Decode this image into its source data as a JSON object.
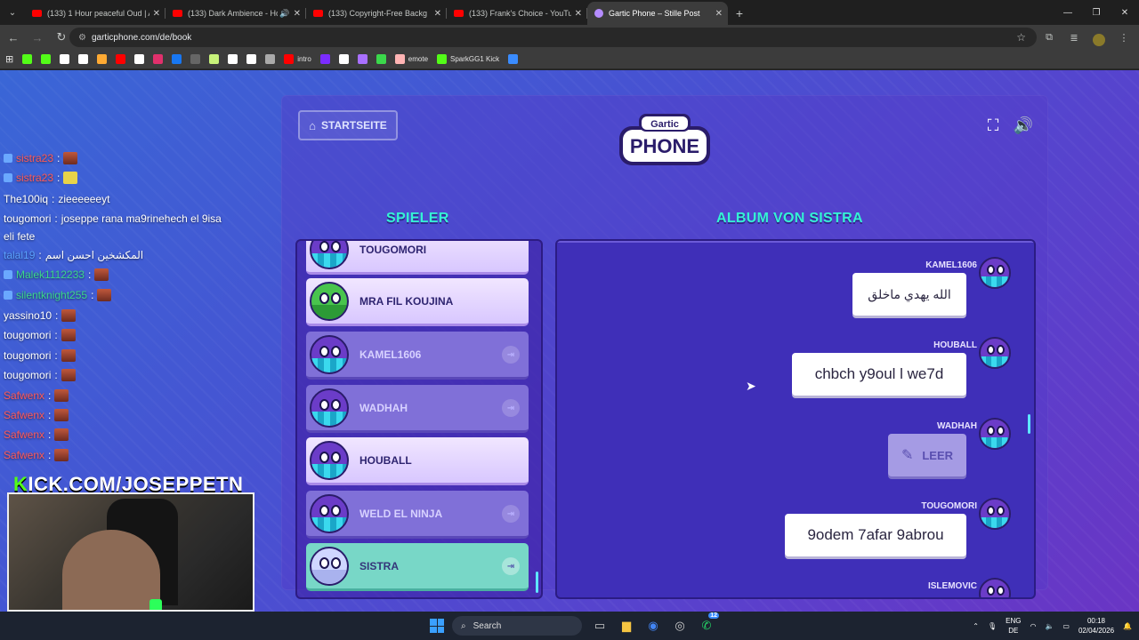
{
  "browser": {
    "tabs": [
      {
        "title": "(133) 1 Hour peaceful Oud | Ar",
        "favicon": "youtube-icon",
        "active": false
      },
      {
        "title": "(133) Dark Ambience - Hor",
        "favicon": "youtube-icon",
        "active": false,
        "audio": true
      },
      {
        "title": "(133) Copyright-Free Backg",
        "favicon": "youtube-icon",
        "active": false
      },
      {
        "title": "(133) Frank's Choice - YouTube",
        "favicon": "youtube-icon",
        "active": false
      },
      {
        "title": "Gartic Phone – Stille Post",
        "favicon": "gartic-icon",
        "active": true
      }
    ],
    "url": "garticphone.com/de/book",
    "bookmarks": [
      "",
      "",
      "",
      "",
      "",
      "",
      "",
      "",
      "",
      "",
      "",
      "",
      "",
      "",
      "intro",
      "",
      "",
      "",
      "",
      "emote",
      "SparkGG1 Kick",
      ""
    ]
  },
  "game": {
    "home_label": "STARTSEITE",
    "logo_top": "Gartic",
    "logo_main": "PHONE",
    "players_title": "SPIELER",
    "album_title": "ALBUM VON SISTRA",
    "players": [
      {
        "name": "TOUGOMORI",
        "style": "bright",
        "avatar": "bird"
      },
      {
        "name": "MRA FIL KOUJINA",
        "style": "bright",
        "avatar": "frog"
      },
      {
        "name": "KAMEL1606",
        "style": "dim",
        "avatar": "bird",
        "exit": true
      },
      {
        "name": "WADHAH",
        "style": "dim",
        "avatar": "bird",
        "exit": true
      },
      {
        "name": "HOUBALL",
        "style": "bright",
        "avatar": "bird"
      },
      {
        "name": "WELD EL NINJA",
        "style": "dim",
        "avatar": "bird",
        "exit": true
      },
      {
        "name": "SISTRA",
        "style": "teal",
        "avatar": "unicorn",
        "exit": true
      }
    ],
    "album": [
      {
        "author": "KAMEL1606",
        "text": "الله يهدي ماخلق",
        "type": "rtl"
      },
      {
        "author": "HOUBALL",
        "text": "chbch y9oul l we7d",
        "type": "text"
      },
      {
        "author": "WADHAH",
        "text": "LEER",
        "type": "empty"
      },
      {
        "author": "TOUGOMORI",
        "text": "9odem 7afar 9abrou",
        "type": "text"
      },
      {
        "author": "ISLEMOVIC",
        "text": "",
        "type": "text"
      }
    ]
  },
  "stream": {
    "chat": [
      {
        "user": "sistra23",
        "msg": "",
        "color": "#ff5a5a",
        "badge": true,
        "emote": "face"
      },
      {
        "user": "sistra23",
        "msg": "",
        "color": "#ff5a5a",
        "badge": true,
        "emote": "yellow"
      },
      {
        "user": "The100iq",
        "msg": "zieeeeeeyt",
        "color": "#ffffff"
      },
      {
        "user": "tougomori",
        "msg": "joseppe rana ma9rinehech el 9isa",
        "color": "#ffffff"
      },
      {
        "user": "",
        "msg": "eli fete",
        "color": "#ffffff"
      },
      {
        "user": "talal19",
        "msg": "المكشخين احسن اسم",
        "color": "#5aa0ff"
      },
      {
        "user": "Malek1112233",
        "msg": "",
        "color": "#3bd88b",
        "badge": true,
        "emote": "face"
      },
      {
        "user": "silentknight255",
        "msg": "",
        "color": "#3bd88b",
        "badge": true,
        "emote": "face"
      },
      {
        "user": "yassino10",
        "msg": "",
        "color": "#ffffff",
        "emote": "face"
      },
      {
        "user": "tougomori",
        "msg": "",
        "color": "#ffffff",
        "emote": "face"
      },
      {
        "user": "tougomori",
        "msg": "",
        "color": "#ffffff",
        "emote": "face"
      },
      {
        "user": "tougomori",
        "msg": "",
        "color": "#ffffff",
        "emote": "face"
      },
      {
        "user": "Safwenx",
        "msg": "",
        "color": "#ff5a5a",
        "emote": "face"
      },
      {
        "user": "Safwenx",
        "msg": "",
        "color": "#ff5a5a",
        "emote": "face"
      },
      {
        "user": "Safwenx",
        "msg": "",
        "color": "#ff5a5a",
        "emote": "face"
      },
      {
        "user": "Safwenx",
        "msg": "",
        "color": "#ff5a5a",
        "emote": "face"
      }
    ],
    "kick_k": "K",
    "kick_text": "ICK.COM/JOSEPPETN"
  },
  "taskbar": {
    "search_label": "Search",
    "lang_top": "ENG",
    "lang_bottom": "DE",
    "time": "00:18",
    "date": "02/04/2026",
    "whatsapp_badge": "12"
  },
  "colors": {
    "accent_teal": "#34f3d4",
    "page_bg_start": "#3a66d6",
    "page_bg_end": "#6a35c4"
  }
}
